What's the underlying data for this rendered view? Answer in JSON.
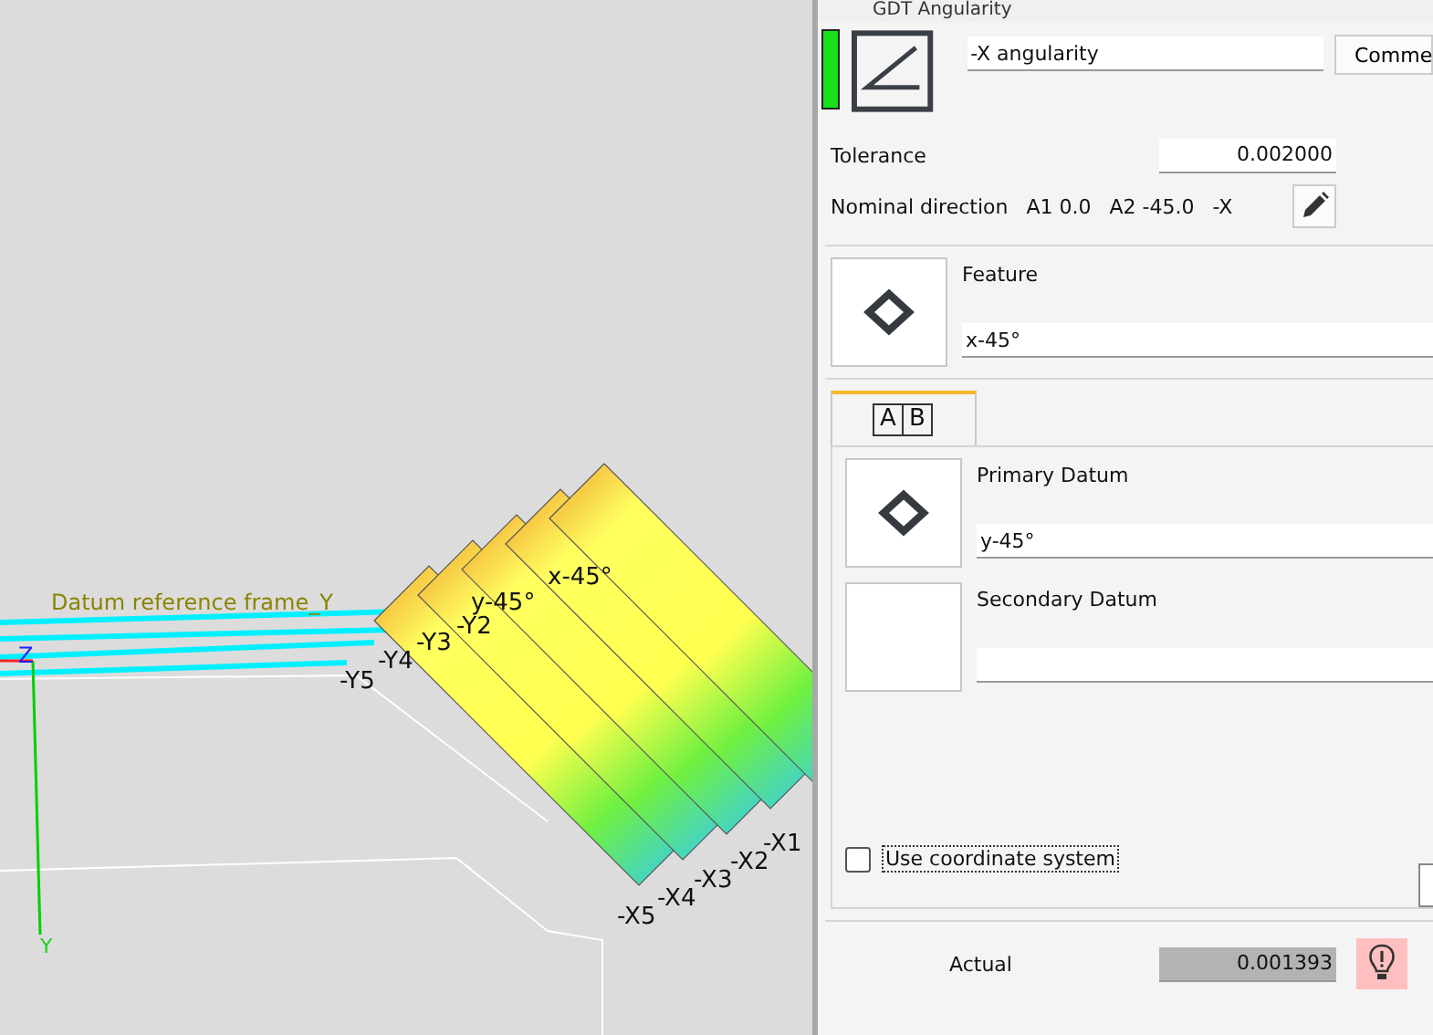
{
  "viewport": {
    "frame_label": "Datum reference frame_Y",
    "axis_labels": [
      "Z",
      "Y"
    ],
    "point_labels": [
      "-Y5",
      "-Y4",
      "-Y3",
      "-Y2",
      "y-45°",
      "x-45°",
      "-X1",
      "-X2",
      "-X3",
      "-X4",
      "-X5"
    ]
  },
  "dialog": {
    "title": "GDT Angularity",
    "passed": true,
    "name": "-X angularity",
    "comment_button": "Comme",
    "tolerance": {
      "label": "Tolerance",
      "value": "0.002000"
    },
    "nominal": {
      "label": "Nominal direction",
      "parts": [
        "A1 0.0",
        "A2 -45.0",
        "-X"
      ]
    },
    "feature": {
      "label": "Feature",
      "value": "x-45°"
    },
    "tabs": [
      {
        "letters": [
          "A",
          "B"
        ],
        "selected": true
      }
    ],
    "datums": [
      {
        "label": "Primary Datum",
        "value": "y-45°",
        "has_symbol": true
      },
      {
        "label": "Secondary Datum",
        "has_symbol": false
      }
    ],
    "use_coordinate_system": {
      "label": "Use coordinate system",
      "checked": false
    },
    "actual": {
      "label": "Actual",
      "value": "0.001393",
      "flagged": true
    }
  }
}
